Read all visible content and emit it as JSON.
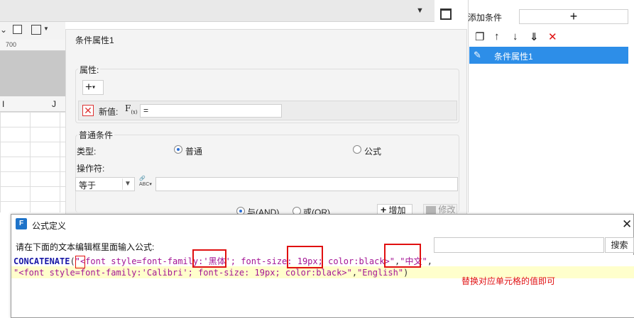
{
  "background_editor": {
    "ruler_value": "700",
    "column_i": "I",
    "column_j": "J"
  },
  "right_panel": {
    "add_condition_label": "添加条件",
    "add_condition_button": "+",
    "condition_item_label": "条件属性1"
  },
  "condition_panel": {
    "title": "条件属性1",
    "attribute_group_label": "属性:",
    "new_value_label": "新值:",
    "new_value": "=",
    "common_group_label": "普通条件",
    "type_label": "类型:",
    "type_normal": "普通",
    "type_formula": "公式",
    "operator_label": "操作符:",
    "operator_value": "等于",
    "and_label": "与(AND)",
    "or_label": "或(OR)",
    "add_button": "增加",
    "modify_button": "修改"
  },
  "formula_dialog": {
    "title": "公式定义",
    "prompt": "请在下面的文本编辑框里面输入公式:",
    "search_button": "搜索",
    "code_line1": {
      "func": "CONCATENATE",
      "p1": "(",
      "s1": "\"<font style=font-family:",
      "s2": "'黑体'",
      "s3": "; font-size:",
      "s4": "19px",
      "s5": "; color:black>\"",
      "p2": ",",
      "s6": "\"中文\"",
      "p3": ","
    },
    "code_line2": {
      "s1": "\"<font style=font-family:'Calibri'; font-size: 19px; color:black>\"",
      "p1": ",",
      "s2": "\"English\"",
      "p2": ")"
    },
    "annotation": "替换对应单元格的值即可"
  },
  "colors": {
    "accent": "#2d8ee8",
    "annotation_red": "#e01010",
    "keyword": "#1a1aa6",
    "string": "#a31595",
    "highlight_line": "#ffffcc"
  }
}
